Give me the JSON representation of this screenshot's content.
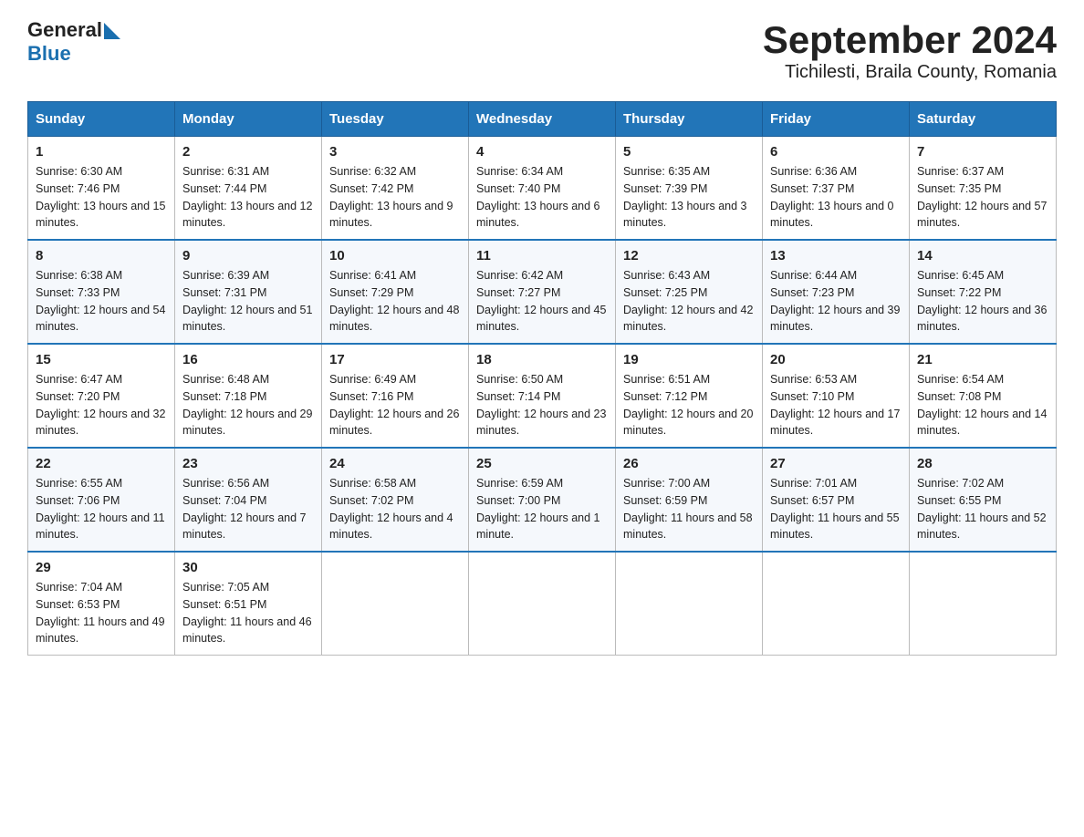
{
  "header": {
    "logo_general": "General",
    "logo_blue": "Blue",
    "title": "September 2024",
    "subtitle": "Tichilesti, Braila County, Romania"
  },
  "days_of_week": [
    "Sunday",
    "Monday",
    "Tuesday",
    "Wednesday",
    "Thursday",
    "Friday",
    "Saturday"
  ],
  "weeks": [
    [
      {
        "day": "1",
        "sunrise": "6:30 AM",
        "sunset": "7:46 PM",
        "daylight": "13 hours and 15 minutes."
      },
      {
        "day": "2",
        "sunrise": "6:31 AM",
        "sunset": "7:44 PM",
        "daylight": "13 hours and 12 minutes."
      },
      {
        "day": "3",
        "sunrise": "6:32 AM",
        "sunset": "7:42 PM",
        "daylight": "13 hours and 9 minutes."
      },
      {
        "day": "4",
        "sunrise": "6:34 AM",
        "sunset": "7:40 PM",
        "daylight": "13 hours and 6 minutes."
      },
      {
        "day": "5",
        "sunrise": "6:35 AM",
        "sunset": "7:39 PM",
        "daylight": "13 hours and 3 minutes."
      },
      {
        "day": "6",
        "sunrise": "6:36 AM",
        "sunset": "7:37 PM",
        "daylight": "13 hours and 0 minutes."
      },
      {
        "day": "7",
        "sunrise": "6:37 AM",
        "sunset": "7:35 PM",
        "daylight": "12 hours and 57 minutes."
      }
    ],
    [
      {
        "day": "8",
        "sunrise": "6:38 AM",
        "sunset": "7:33 PM",
        "daylight": "12 hours and 54 minutes."
      },
      {
        "day": "9",
        "sunrise": "6:39 AM",
        "sunset": "7:31 PM",
        "daylight": "12 hours and 51 minutes."
      },
      {
        "day": "10",
        "sunrise": "6:41 AM",
        "sunset": "7:29 PM",
        "daylight": "12 hours and 48 minutes."
      },
      {
        "day": "11",
        "sunrise": "6:42 AM",
        "sunset": "7:27 PM",
        "daylight": "12 hours and 45 minutes."
      },
      {
        "day": "12",
        "sunrise": "6:43 AM",
        "sunset": "7:25 PM",
        "daylight": "12 hours and 42 minutes."
      },
      {
        "day": "13",
        "sunrise": "6:44 AM",
        "sunset": "7:23 PM",
        "daylight": "12 hours and 39 minutes."
      },
      {
        "day": "14",
        "sunrise": "6:45 AM",
        "sunset": "7:22 PM",
        "daylight": "12 hours and 36 minutes."
      }
    ],
    [
      {
        "day": "15",
        "sunrise": "6:47 AM",
        "sunset": "7:20 PM",
        "daylight": "12 hours and 32 minutes."
      },
      {
        "day": "16",
        "sunrise": "6:48 AM",
        "sunset": "7:18 PM",
        "daylight": "12 hours and 29 minutes."
      },
      {
        "day": "17",
        "sunrise": "6:49 AM",
        "sunset": "7:16 PM",
        "daylight": "12 hours and 26 minutes."
      },
      {
        "day": "18",
        "sunrise": "6:50 AM",
        "sunset": "7:14 PM",
        "daylight": "12 hours and 23 minutes."
      },
      {
        "day": "19",
        "sunrise": "6:51 AM",
        "sunset": "7:12 PM",
        "daylight": "12 hours and 20 minutes."
      },
      {
        "day": "20",
        "sunrise": "6:53 AM",
        "sunset": "7:10 PM",
        "daylight": "12 hours and 17 minutes."
      },
      {
        "day": "21",
        "sunrise": "6:54 AM",
        "sunset": "7:08 PM",
        "daylight": "12 hours and 14 minutes."
      }
    ],
    [
      {
        "day": "22",
        "sunrise": "6:55 AM",
        "sunset": "7:06 PM",
        "daylight": "12 hours and 11 minutes."
      },
      {
        "day": "23",
        "sunrise": "6:56 AM",
        "sunset": "7:04 PM",
        "daylight": "12 hours and 7 minutes."
      },
      {
        "day": "24",
        "sunrise": "6:58 AM",
        "sunset": "7:02 PM",
        "daylight": "12 hours and 4 minutes."
      },
      {
        "day": "25",
        "sunrise": "6:59 AM",
        "sunset": "7:00 PM",
        "daylight": "12 hours and 1 minute."
      },
      {
        "day": "26",
        "sunrise": "7:00 AM",
        "sunset": "6:59 PM",
        "daylight": "11 hours and 58 minutes."
      },
      {
        "day": "27",
        "sunrise": "7:01 AM",
        "sunset": "6:57 PM",
        "daylight": "11 hours and 55 minutes."
      },
      {
        "day": "28",
        "sunrise": "7:02 AM",
        "sunset": "6:55 PM",
        "daylight": "11 hours and 52 minutes."
      }
    ],
    [
      {
        "day": "29",
        "sunrise": "7:04 AM",
        "sunset": "6:53 PM",
        "daylight": "11 hours and 49 minutes."
      },
      {
        "day": "30",
        "sunrise": "7:05 AM",
        "sunset": "6:51 PM",
        "daylight": "11 hours and 46 minutes."
      },
      null,
      null,
      null,
      null,
      null
    ]
  ]
}
